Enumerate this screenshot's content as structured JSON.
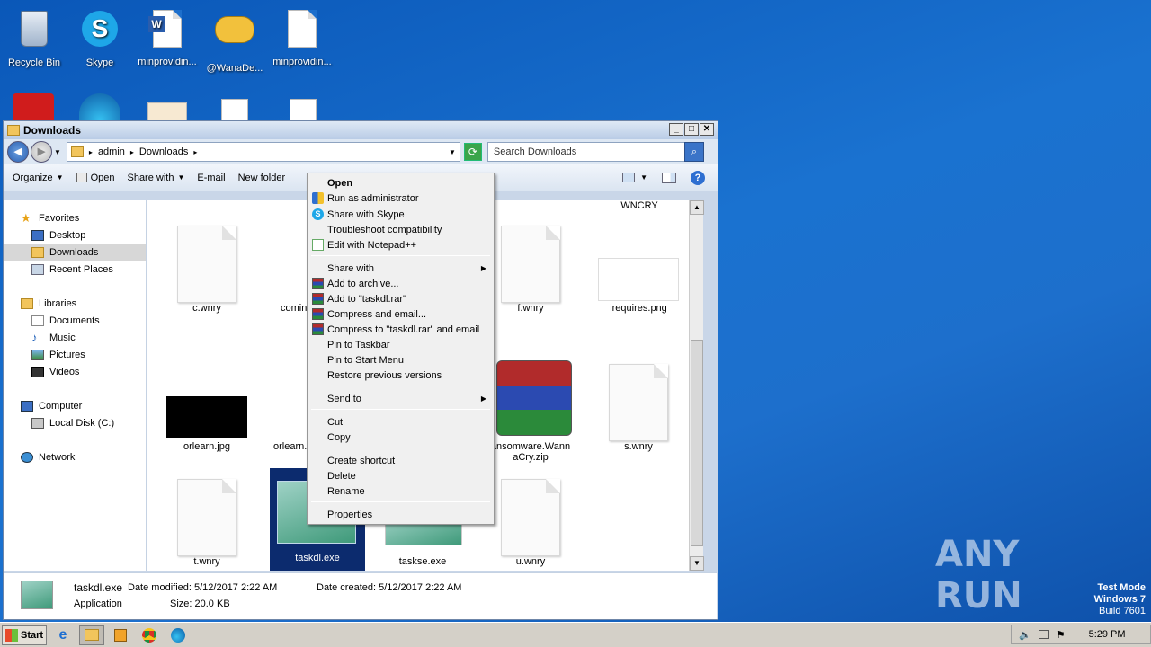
{
  "desktop": {
    "icons": [
      {
        "label": "Recycle Bin"
      },
      {
        "label": "Skype"
      },
      {
        "label": "minprovidin..."
      },
      {
        "label": "@WanaDe..."
      },
      {
        "label": "minprovidin..."
      }
    ]
  },
  "window": {
    "title": "Downloads",
    "breadcrumb": [
      "admin",
      "Downloads"
    ],
    "search_placeholder": "Search Downloads",
    "toolbar": {
      "organize": "Organize",
      "open": "Open",
      "share_with": "Share with",
      "email": "E-mail",
      "new_folder": "New folder"
    }
  },
  "nav": {
    "favorites": "Favorites",
    "desktop": "Desktop",
    "downloads": "Downloads",
    "recent_places": "Recent Places",
    "libraries": "Libraries",
    "documents": "Documents",
    "music": "Music",
    "pictures": "Pictures",
    "videos": "Videos",
    "computer": "Computer",
    "local_disk": "Local Disk (C:)",
    "network": "Network"
  },
  "files": {
    "wncry": "WNCRY",
    "c_wnry": "c.wnry",
    "coming": "coming",
    "f_wnry": "f.wnry",
    "irequires": "irequires.png",
    "orlearn_jpg": "orlearn.jpg",
    "orlearn2": "orlearn.",
    "ransomware_zip": "ansomware.Wann aCry.zip",
    "s_wnry": "s.wnry",
    "t_wnry": "t.wnry",
    "taskdl": "taskdl.exe",
    "taskse": "taskse.exe",
    "u_wnry": "u.wnry"
  },
  "details": {
    "name": "taskdl.exe",
    "type": "Application",
    "date_modified": "Date modified: 5/12/2017 2:22 AM",
    "size": "Size: 20.0 KB",
    "date_created": "Date created: 5/12/2017 2:22 AM"
  },
  "context_menu": {
    "open": "Open",
    "run_admin": "Run as administrator",
    "share_skype": "Share with Skype",
    "troubleshoot": "Troubleshoot compatibility",
    "notepad": "Edit with Notepad++",
    "share_with": "Share with",
    "add_archive": "Add to archive...",
    "add_rar": "Add to \"taskdl.rar\"",
    "compress_email": "Compress and email...",
    "compress_rar_email": "Compress to \"taskdl.rar\" and email",
    "pin_taskbar": "Pin to Taskbar",
    "pin_start": "Pin to Start Menu",
    "restore": "Restore previous versions",
    "send_to": "Send to",
    "cut": "Cut",
    "copy": "Copy",
    "create_shortcut": "Create shortcut",
    "delete": "Delete",
    "rename": "Rename",
    "properties": "Properties"
  },
  "taskbar": {
    "start": "Start",
    "clock": "5:29 PM"
  },
  "watermark": {
    "text": "ANY RUN",
    "test_mode": "Test Mode",
    "os": "Windows 7",
    "build": "Build 7601"
  },
  "colors": {
    "desktop_bg": "#1a72d0",
    "selection": "#0c2b6e"
  }
}
